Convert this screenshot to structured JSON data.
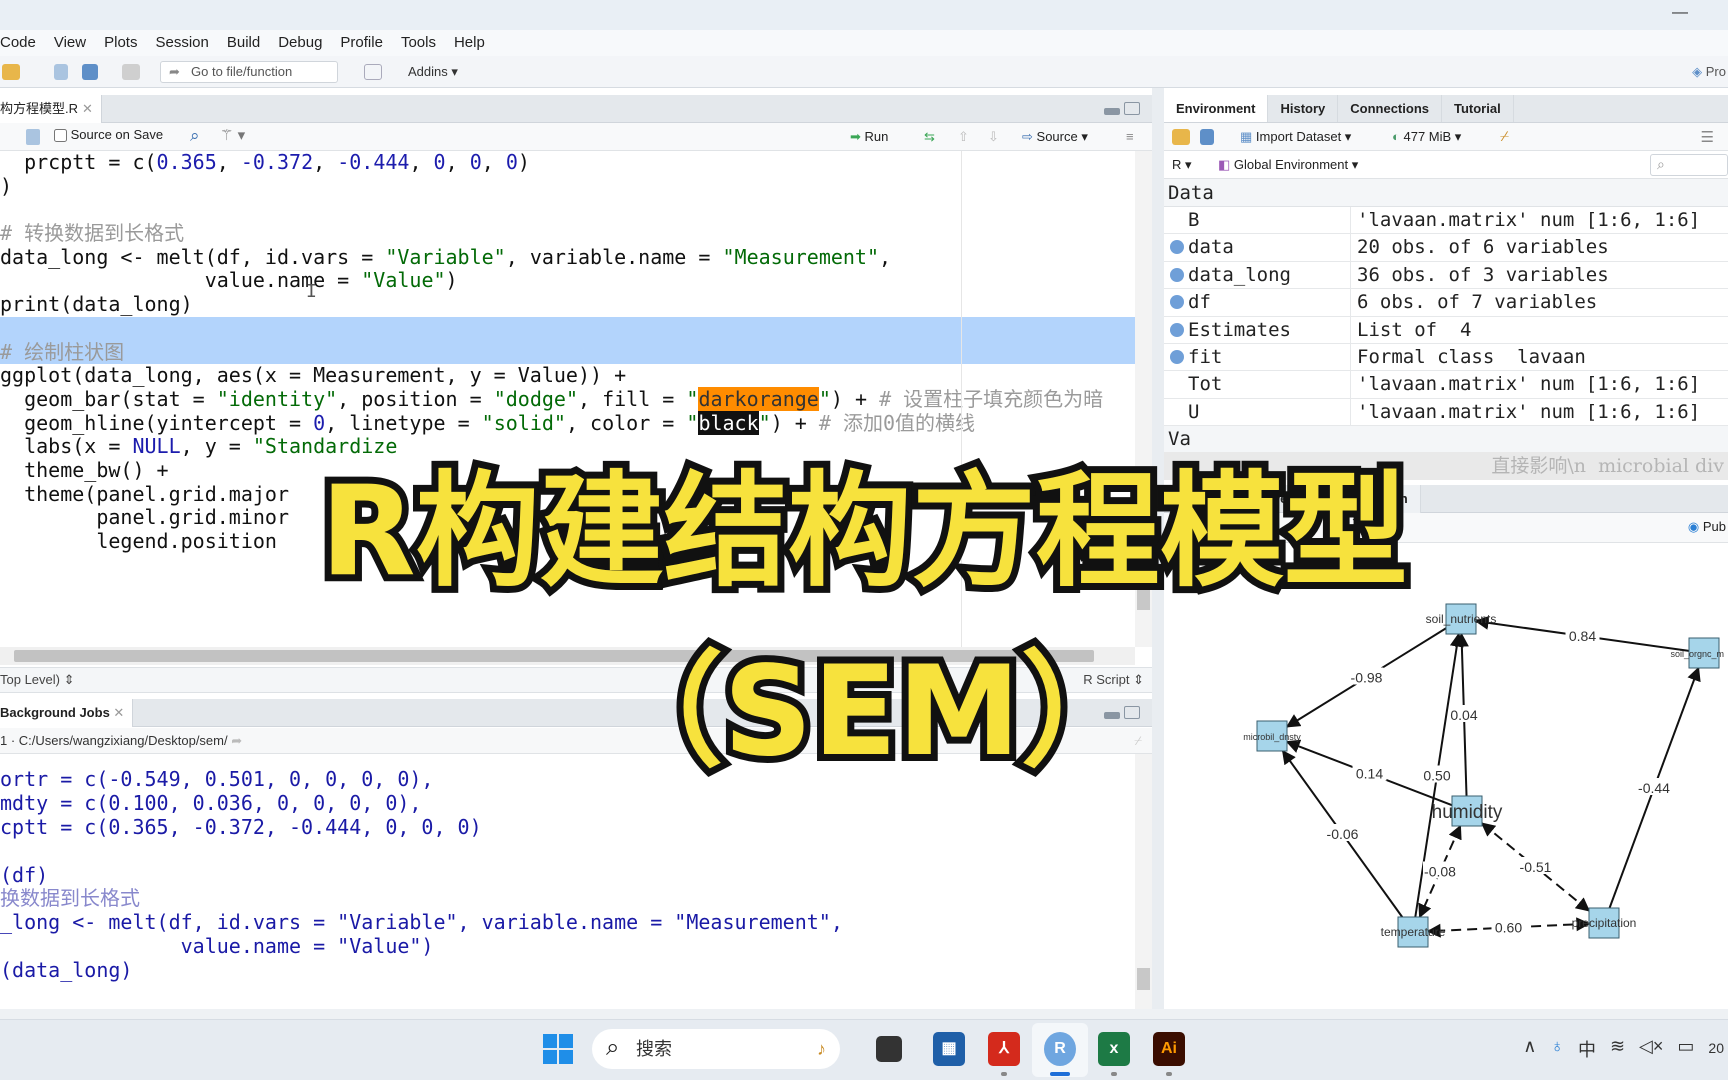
{
  "menu": [
    "Code",
    "View",
    "Plots",
    "Session",
    "Build",
    "Debug",
    "Profile",
    "Tools",
    "Help"
  ],
  "toolbar": {
    "goto_placeholder": "Go to file/function",
    "addins": "Addins",
    "project": "Pro"
  },
  "editor": {
    "tab_label": "构方程模型.R",
    "source_on_save": "Source on Save",
    "run": "Run",
    "source": "Source",
    "status_scope": "Top Level)",
    "status_type": "R Script",
    "lines": [
      [
        [
          "  prcptt = c(",
          "k"
        ],
        [
          "0.365",
          "n"
        ],
        [
          ", ",
          "k"
        ],
        [
          "-0.372",
          "n"
        ],
        [
          ", ",
          "k"
        ],
        [
          "-0.444",
          "n"
        ],
        [
          ", ",
          "k"
        ],
        [
          "0",
          "n"
        ],
        [
          ", ",
          "k"
        ],
        [
          "0",
          "n"
        ],
        [
          ", ",
          "k"
        ],
        [
          "0",
          "n"
        ],
        [
          ")",
          "k"
        ]
      ],
      [
        [
          ")",
          "k"
        ]
      ],
      [],
      [
        [
          "# 转换数据到长格式",
          "c"
        ]
      ],
      [
        [
          "data_long <- melt(df, id.vars = ",
          "k"
        ],
        [
          "\"Variable\"",
          "s"
        ],
        [
          ", variable.name = ",
          "k"
        ],
        [
          "\"Measurement\"",
          "s"
        ],
        [
          ",",
          "k"
        ]
      ],
      [
        [
          "                 value.name = ",
          "k"
        ],
        [
          "\"Value\"",
          "s"
        ],
        [
          ")",
          "k"
        ]
      ],
      [
        [
          "print(data_long)",
          "k"
        ]
      ],
      [],
      [
        [
          "# 绘制柱状图",
          "c"
        ]
      ],
      [
        [
          "ggplot(data_long, aes(x = Measurement, y = Value)) +",
          "k"
        ]
      ],
      [
        [
          "  geom_bar(stat = ",
          "k"
        ],
        [
          "\"identity\"",
          "s"
        ],
        [
          ", position = ",
          "k"
        ],
        [
          "\"dodge\"",
          "s"
        ],
        [
          ", fill = ",
          "k"
        ],
        [
          "\"",
          "s"
        ],
        [
          "darkorange",
          "hl1"
        ],
        [
          "\"",
          "s"
        ],
        [
          ") + ",
          "k"
        ],
        [
          "# 设置柱子填充颜色为暗",
          "c"
        ]
      ],
      [
        [
          "  geom_hline(yintercept = ",
          "k"
        ],
        [
          "0",
          "n"
        ],
        [
          ", linetype = ",
          "k"
        ],
        [
          "\"solid\"",
          "s"
        ],
        [
          ", color = ",
          "k"
        ],
        [
          "\"",
          "s"
        ],
        [
          "black",
          "hl2"
        ],
        [
          "\"",
          "s"
        ],
        [
          ") + ",
          "k"
        ],
        [
          "# 添加0值的横线",
          "c"
        ]
      ],
      [
        [
          "  labs(x = ",
          "k"
        ],
        [
          "NULL",
          "n"
        ],
        [
          ", y = ",
          "k"
        ],
        [
          "\"Standardize",
          "s"
        ]
      ],
      [
        [
          "  theme_bw() +",
          "k"
        ]
      ],
      [
        [
          "  theme(panel.grid.major",
          "k"
        ]
      ],
      [
        [
          "        panel.grid.minor",
          "k"
        ]
      ],
      [
        [
          "        legend.position",
          "k"
        ]
      ]
    ],
    "selected_lines": [
      7,
      8
    ]
  },
  "console": {
    "tab_label": "Background Jobs",
    "path": "C:/Users/wangzixiang/Desktop/sem/",
    "lines": [
      "ortr = c(-0.549, 0.501, 0, 0, 0, 0),",
      "mdty = c(0.100, 0.036, 0, 0, 0, 0),",
      "cptt = c(0.365, -0.372, -0.444, 0, 0, 0)",
      "",
      "(df)",
      "换数据到长格式",
      "_long <- melt(df, id.vars = \"Variable\", variable.name = \"Measurement\",",
      "               value.name = \"Value\")",
      "(data_long)"
    ]
  },
  "environment": {
    "tabs": [
      "Environment",
      "History",
      "Connections",
      "Tutorial"
    ],
    "import_dataset": "Import Dataset",
    "memory": "477 MiB",
    "lang": "R",
    "scope": "Global Environment",
    "data_header": "Data",
    "rows": [
      {
        "name": "B",
        "value": "'lavaan.matrix' num [1:6, 1:6]",
        "expandable": false
      },
      {
        "name": "data",
        "value": "20 obs. of 6 variables",
        "expandable": true
      },
      {
        "name": "data_long",
        "value": "36 obs. of 3 variables",
        "expandable": true
      },
      {
        "name": "df",
        "value": "6 obs. of 7 variables",
        "expandable": true
      },
      {
        "name": "Estimates",
        "value": "List of  4",
        "expandable": true
      },
      {
        "name": "fit",
        "value": "Formal class  lavaan",
        "expandable": true
      },
      {
        "name": "Tot",
        "value": "'lavaan.matrix' num [1:6, 1:6]",
        "expandable": false
      },
      {
        "name": "U",
        "value": "'lavaan.matrix' num [1:6, 1:6]",
        "expandable": false
      }
    ],
    "values_header": "Va",
    "faded_text": "直接影响\\n  microbial div"
  },
  "plots": {
    "tab_partial": "wer",
    "tab_presentation": "Presentation",
    "publish": "Pub",
    "diagram": {
      "nodes": [
        {
          "id": "soil_nutrients",
          "label": "soil_nutrients"
        },
        {
          "id": "soil_orgnc_m",
          "label": "soil_orgnc_m"
        },
        {
          "id": "microbil_dnsty",
          "label": "microbil_dnsty"
        },
        {
          "id": "humidity",
          "label": "humidity"
        },
        {
          "id": "temperature",
          "label": "temperature"
        },
        {
          "id": "precipitation",
          "label": "precipitation"
        }
      ],
      "edges": [
        {
          "from": "soil_nutrients",
          "to": "microbil_dnsty",
          "label": "-0.98",
          "dashed": false,
          "both": false
        },
        {
          "from": "soil_orgnc_m",
          "to": "soil_nutrients",
          "label": "0.84",
          "dashed": false,
          "both": false
        },
        {
          "from": "humidity",
          "to": "soil_nutrients",
          "label": "0.04",
          "dashed": false,
          "both": false
        },
        {
          "from": "temperature",
          "to": "soil_nutrients",
          "label": "0.50",
          "dashed": false,
          "both": false
        },
        {
          "from": "humidity",
          "to": "microbil_dnsty",
          "label": "0.14",
          "dashed": false,
          "both": false
        },
        {
          "from": "temperature",
          "to": "microbil_dnsty",
          "label": "-0.06",
          "dashed": false,
          "both": false
        },
        {
          "from": "precipitation",
          "to": "soil_orgnc_m",
          "label": "-0.44",
          "dashed": false,
          "both": false
        },
        {
          "from": "humidity",
          "to": "temperature",
          "label": "-0.08",
          "dashed": true,
          "both": true
        },
        {
          "from": "humidity",
          "to": "precipitation",
          "label": "-0.51",
          "dashed": true,
          "both": true
        },
        {
          "from": "precipitation",
          "to": "temperature",
          "label": "0.60",
          "dashed": true,
          "both": true
        }
      ],
      "node_fill": "#a6d5ea"
    }
  },
  "taskbar": {
    "search_placeholder": "搜索",
    "apps": [
      "file-explorer",
      "microsoft-store",
      "acrobat",
      "rstudio",
      "excel",
      "illustrator"
    ],
    "tray_ime": "中",
    "clock_partial": "20"
  },
  "overlay": {
    "title_line1": "R构建结构方程模型",
    "title_line2": "（SEM）",
    "color": "#f7e23d"
  }
}
